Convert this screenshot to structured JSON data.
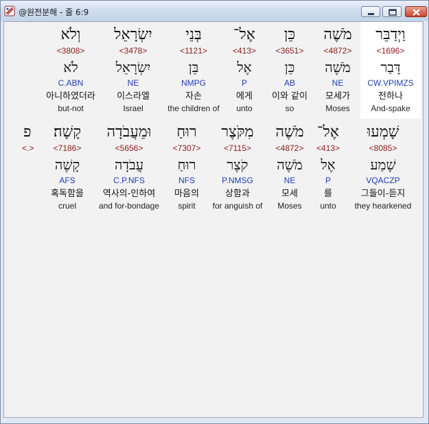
{
  "window": {
    "title": "@원전분해 - 줄 6:9"
  },
  "verse": {
    "words": [
      {
        "hebrew": "וַיְדַבֵּר",
        "strong": "<1696>",
        "root": "דָּבַר",
        "morph": "CW.VPIMZS",
        "korean": "전하나",
        "english": "And-spake"
      },
      {
        "hebrew": "מֹשֶׁה",
        "strong": "<4872>",
        "root": "מֹשֶׁה",
        "morph": "NE",
        "korean": "모세가",
        "english": "Moses"
      },
      {
        "hebrew": "כֵּן",
        "strong": "<3651>",
        "root": "כֵּן",
        "morph": "AB",
        "korean": "이와 같이",
        "english": "so"
      },
      {
        "hebrew": "אֶל־",
        "strong": "<413>",
        "root": "אֶל",
        "morph": "P",
        "korean": "에게",
        "english": "unto"
      },
      {
        "hebrew": "בְּנֵי",
        "strong": "<1121>",
        "root": "בֵּן",
        "morph": "NMPG",
        "korean": "자손",
        "english": "the children of"
      },
      {
        "hebrew": "יִשְׂרָאֵל",
        "strong": "<3478>",
        "root": "יִשְׂרָאֵל",
        "morph": "NE",
        "korean": "이스라엘",
        "english": "Israel"
      },
      {
        "hebrew": "וְלֹא",
        "strong": "<3808>",
        "root": "לֹא",
        "morph": "C.ABN",
        "korean": "아니하였더라",
        "english": "but-not"
      },
      {
        "hebrew": "שָׁמְעוּ",
        "strong": "<8085>",
        "root": "שָׁמַע",
        "morph": "VQACZP",
        "korean": "그들이-듣지",
        "english": "they hearkened"
      },
      {
        "hebrew": "אֶל־",
        "strong": "<413>",
        "root": "אֶל",
        "morph": "P",
        "korean": "를",
        "english": "unto"
      },
      {
        "hebrew": "מֹשֶׁה",
        "strong": "<4872>",
        "root": "מֹשֶׁה",
        "morph": "NE",
        "korean": "모세",
        "english": "Moses"
      },
      {
        "hebrew": "מִקֹּצֶר",
        "strong": "<7115>",
        "root": "קֹצֶר",
        "morph": "P.NMSG",
        "korean": "상함과",
        "english": "for anguish of"
      },
      {
        "hebrew": "רוּחַ",
        "strong": "<7307>",
        "root": "רוּחַ",
        "morph": "NFS",
        "korean": "마음의",
        "english": "spirit"
      },
      {
        "hebrew": "וּמֵעֲבֹדָה",
        "strong": "<5656>",
        "root": "עֲבֹדָה",
        "morph": "C.P.NFS",
        "korean": "역사의-인하여",
        "english": "and for-bondage"
      },
      {
        "hebrew": "קָשָׁה׃",
        "strong": "<7186>",
        "root": "קָשֶׁה",
        "morph": "AFS",
        "korean": "혹독함을",
        "english": "cruel"
      },
      {
        "hebrew": "פ",
        "strong": "<.>",
        "root": "",
        "morph": "",
        "korean": "",
        "english": ""
      }
    ]
  }
}
